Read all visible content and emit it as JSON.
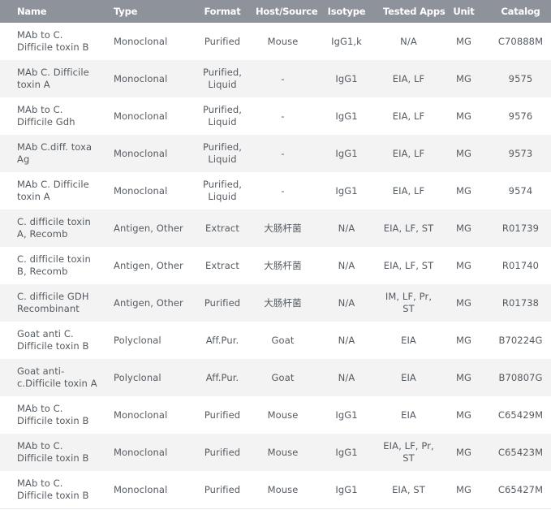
{
  "headers": [
    "Name",
    "Type",
    "Format",
    "Host/Source",
    "Isotype",
    "Tested Apps",
    "Unit",
    "Catalog"
  ],
  "rows": [
    {
      "name": "MAb to C. Difficile toxin B",
      "type": "Monoclonal",
      "format": "Purified",
      "host": "Mouse",
      "isotype": "IgG1,k",
      "apps": "N/A",
      "unit": "MG",
      "catalog": "C70888M"
    },
    {
      "name": "MAb C. Difficile toxin A",
      "type": "Monoclonal",
      "format": "Purified, Liquid",
      "host": "-",
      "isotype": "IgG1",
      "apps": "EIA, LF",
      "unit": "MG",
      "catalog": "9575"
    },
    {
      "name": "MAb to C. Difficile Gdh",
      "type": "Monoclonal",
      "format": "Purified, Liquid",
      "host": "-",
      "isotype": "IgG1",
      "apps": "EIA, LF",
      "unit": "MG",
      "catalog": "9576"
    },
    {
      "name": "MAb C.diff. toxa Ag",
      "type": "Monoclonal",
      "format": "Purified, Liquid",
      "host": "-",
      "isotype": "IgG1",
      "apps": "EIA, LF",
      "unit": "MG",
      "catalog": "9573"
    },
    {
      "name": "MAb C. Difficile toxin A",
      "type": "Monoclonal",
      "format": "Purified, Liquid",
      "host": "-",
      "isotype": "IgG1",
      "apps": "EIA, LF",
      "unit": "MG",
      "catalog": "9574"
    },
    {
      "name": "C. difficile toxin A, Recomb",
      "type": "Antigen, Other",
      "format": "Extract",
      "host": "大肠杆菌",
      "isotype": "N/A",
      "apps": "EIA, LF, ST",
      "unit": "MG",
      "catalog": "R01739"
    },
    {
      "name": "C. difficile toxin B, Recomb",
      "type": "Antigen, Other",
      "format": "Extract",
      "host": "大肠杆菌",
      "isotype": "N/A",
      "apps": "EIA, LF, ST",
      "unit": "MG",
      "catalog": "R01740"
    },
    {
      "name": "C. difficile GDH Recombinant",
      "type": "Antigen, Other",
      "format": "Purified",
      "host": "大肠杆菌",
      "isotype": "N/A",
      "apps": "IM, LF, Pr, ST",
      "unit": "MG",
      "catalog": "R01738"
    },
    {
      "name": "Goat anti C. Difficile toxin B",
      "type": "Polyclonal",
      "format": "Aff.Pur.",
      "host": "Goat",
      "isotype": "N/A",
      "apps": "EIA",
      "unit": "MG",
      "catalog": "B70224G"
    },
    {
      "name": "Goat anti-c.Difficile toxin A",
      "type": "Polyclonal",
      "format": "Aff.Pur.",
      "host": "Goat",
      "isotype": "N/A",
      "apps": "EIA",
      "unit": "MG",
      "catalog": "B70807G"
    },
    {
      "name": "MAb to C. Difficile toxin B",
      "type": "Monoclonal",
      "format": "Purified",
      "host": "Mouse",
      "isotype": "IgG1",
      "apps": "EIA",
      "unit": "MG",
      "catalog": "C65429M"
    },
    {
      "name": "MAb to C. Difficile toxin B",
      "type": "Monoclonal",
      "format": "Purified",
      "host": "Mouse",
      "isotype": "IgG1",
      "apps": "EIA, LF, Pr, ST",
      "unit": "MG",
      "catalog": "C65423M"
    },
    {
      "name": "MAb to C. Difficile toxin B",
      "type": "Monoclonal",
      "format": "Purified",
      "host": "Mouse",
      "isotype": "IgG1",
      "apps": "EIA, ST",
      "unit": "MG",
      "catalog": "C65427M"
    }
  ]
}
